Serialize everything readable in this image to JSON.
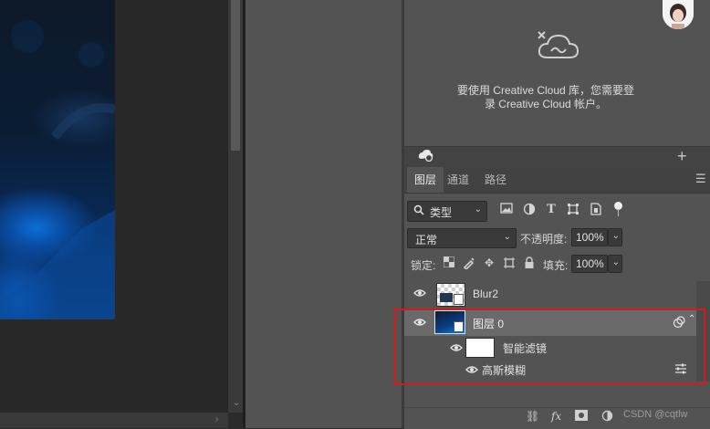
{
  "libraries": {
    "message_line1": "要使用 Creative Cloud 库，您需要登",
    "message_line2": "录 Creative Cloud 帐户。",
    "add_label": "+"
  },
  "layers_panel": {
    "tabs": [
      {
        "label": "图层",
        "active": true
      },
      {
        "label": "通道",
        "active": false
      },
      {
        "label": "路径",
        "active": false
      }
    ],
    "kind_filter": "类型",
    "blend_mode": "正常",
    "opacity_label": "不透明度:",
    "opacity_value": "100%",
    "lock_label": "锁定:",
    "fill_label": "填充:",
    "fill_value": "100%",
    "layers": [
      {
        "name": "Blur2",
        "visible": true,
        "selected": false
      },
      {
        "name": "图层 0",
        "visible": true,
        "selected": true
      }
    ],
    "smart_filters_label": "智能滤镜",
    "filter_name": "高斯模糊"
  },
  "watermark": "CSDN @cqtlw",
  "colors": {
    "panel_bg": "#535353",
    "selected_row": "#6a6a6a",
    "highlight_border": "#d21b1b"
  }
}
